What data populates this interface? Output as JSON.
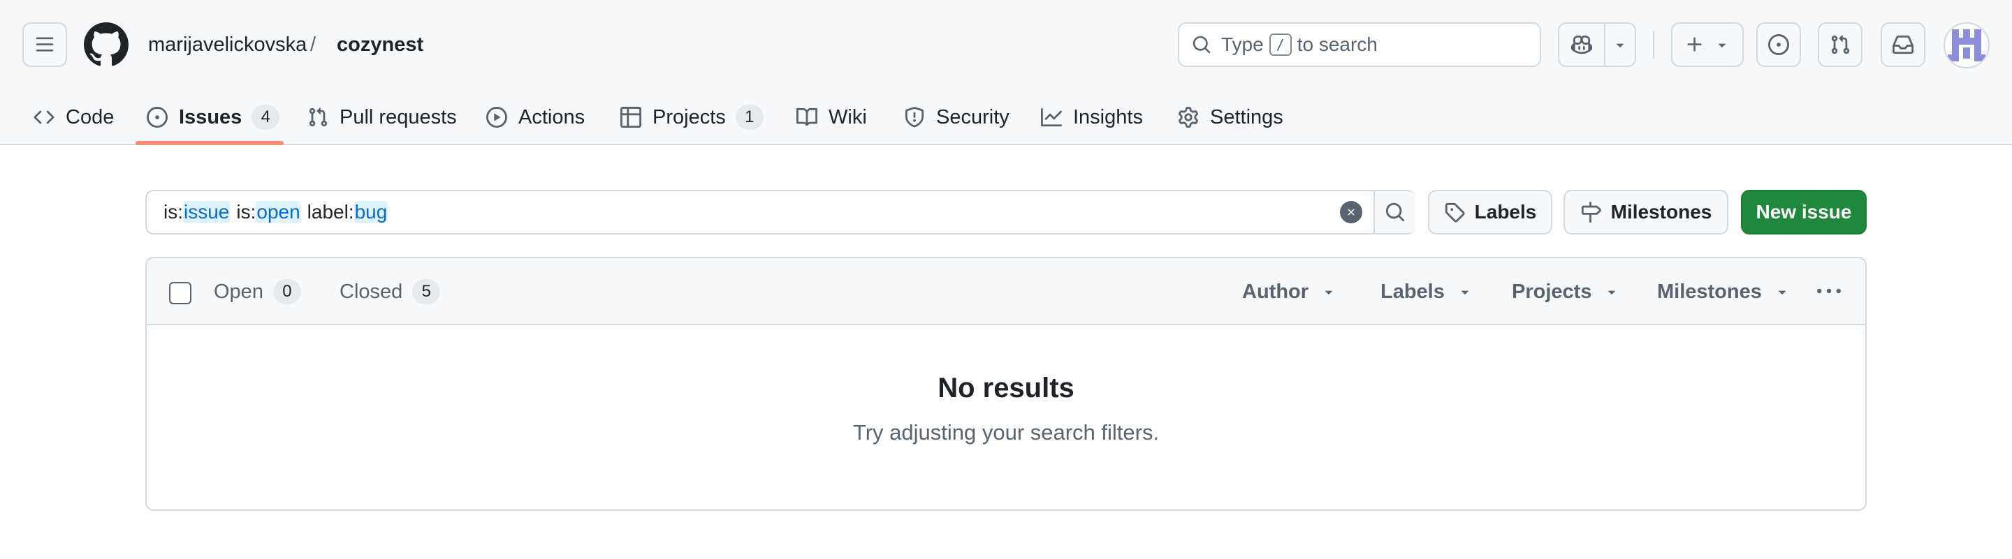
{
  "colors": {
    "accent": "#0969da",
    "primary_button": "#1f883d",
    "nav_underline": "#fd8c73",
    "muted": "#59636e",
    "border": "#d1d9e0"
  },
  "header": {
    "owner": "marijavelickovska",
    "separator": "/",
    "repo": "cozynest",
    "search": {
      "prefix": "Type",
      "key": "/",
      "suffix": "to search"
    },
    "icons": [
      "hamburger-icon",
      "github-logo",
      "search-icon",
      "copilot-icon",
      "triangle-down-icon",
      "plus-icon",
      "issue-opened-icon",
      "git-pull-request-icon",
      "inbox-icon",
      "avatar"
    ]
  },
  "repo_nav": {
    "items": [
      {
        "label": "Code",
        "icon": "code-icon"
      },
      {
        "label": "Issues",
        "icon": "issue-opened-icon",
        "count": "4",
        "selected": true
      },
      {
        "label": "Pull requests",
        "icon": "git-pull-request-icon"
      },
      {
        "label": "Actions",
        "icon": "play-icon"
      },
      {
        "label": "Projects",
        "icon": "table-icon",
        "count": "1"
      },
      {
        "label": "Wiki",
        "icon": "book-icon"
      },
      {
        "label": "Security",
        "icon": "shield-icon"
      },
      {
        "label": "Insights",
        "icon": "graph-icon"
      },
      {
        "label": "Settings",
        "icon": "gear-icon"
      }
    ]
  },
  "filter": {
    "query": [
      {
        "key": "is:",
        "value": "issue"
      },
      {
        "key": "is:",
        "value": "open"
      },
      {
        "key": "label:",
        "value": "bug"
      }
    ]
  },
  "actions": {
    "labels": "Labels",
    "milestones": "Milestones",
    "new_issue": "New issue"
  },
  "list": {
    "open_label": "Open",
    "open_count": "0",
    "closed_label": "Closed",
    "closed_count": "5",
    "filters": {
      "author": "Author",
      "labels": "Labels",
      "projects": "Projects",
      "milestones": "Milestones"
    },
    "empty_title": "No results",
    "empty_subtitle": "Try adjusting your search filters."
  }
}
